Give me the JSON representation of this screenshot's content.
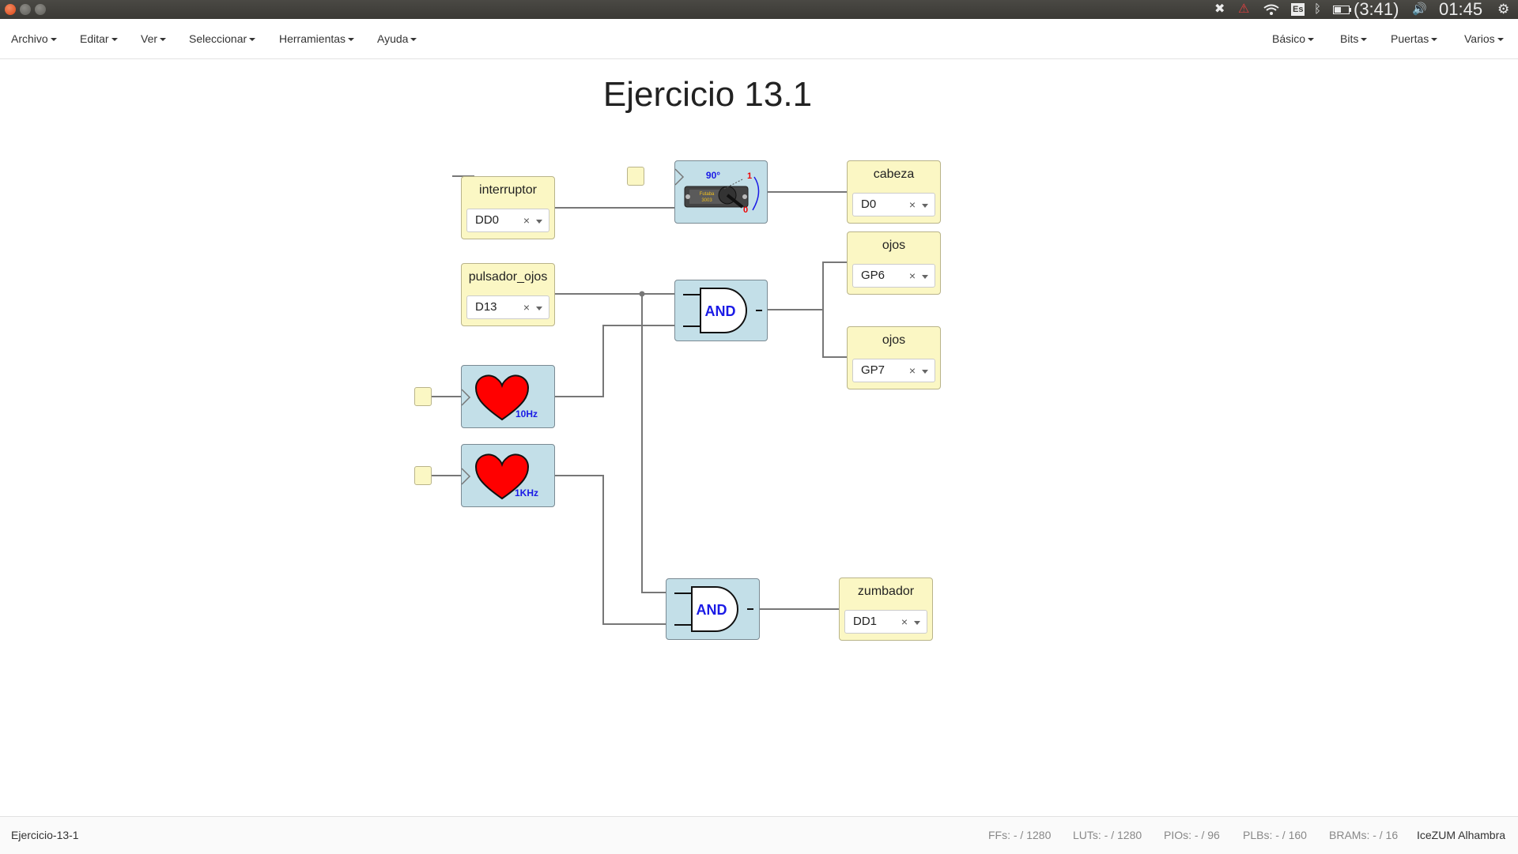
{
  "system_bar": {
    "keyboard_layout": "Es",
    "battery_time": "(3:41)",
    "clock": "01:45"
  },
  "menubar": {
    "left": [
      "Archivo",
      "Editar",
      "Ver",
      "Seleccionar",
      "Herramientas",
      "Ayuda"
    ],
    "right": [
      "Básico",
      "Bits",
      "Puertas",
      "Varios"
    ]
  },
  "canvas": {
    "title": "Ejercicio 13.1",
    "inputs": {
      "interruptor": {
        "label": "interruptor",
        "pin": "DD0"
      },
      "pulsador_ojos": {
        "label": "pulsador_ojos",
        "pin": "D13"
      }
    },
    "outputs": {
      "cabeza": {
        "label": "cabeza",
        "pin": "D0"
      },
      "ojos1": {
        "label": "ojos",
        "pin": "GP6"
      },
      "ojos2": {
        "label": "ojos",
        "pin": "GP7"
      },
      "zumbador": {
        "label": "zumbador",
        "pin": "DD1"
      }
    },
    "blocks": {
      "servo": {
        "angle": "90°",
        "one": "1",
        "zero": "0",
        "brand": "Futaba",
        "model": "3003"
      },
      "and1": {
        "label": "AND"
      },
      "and2": {
        "label": "AND"
      },
      "heart1": {
        "freq": "10Hz"
      },
      "heart2": {
        "freq": "1KHz"
      }
    },
    "clear_symbol": "×"
  },
  "statusbar": {
    "filename": "Ejercicio-13-1",
    "ffs": "FFs:  - / 1280",
    "luts": "LUTs:  - / 1280",
    "pios": "PIOs:  - / 96",
    "plbs": "PLBs:  - / 160",
    "brams": "BRAMs:  - / 16",
    "board": "IceZUM Alhambra"
  },
  "colors": {
    "io_block": "#fbf7c4",
    "code_block": "#c3dfe8",
    "wire": "#777777",
    "and_text": "#1a1ae6",
    "heart": "#ff0000"
  }
}
